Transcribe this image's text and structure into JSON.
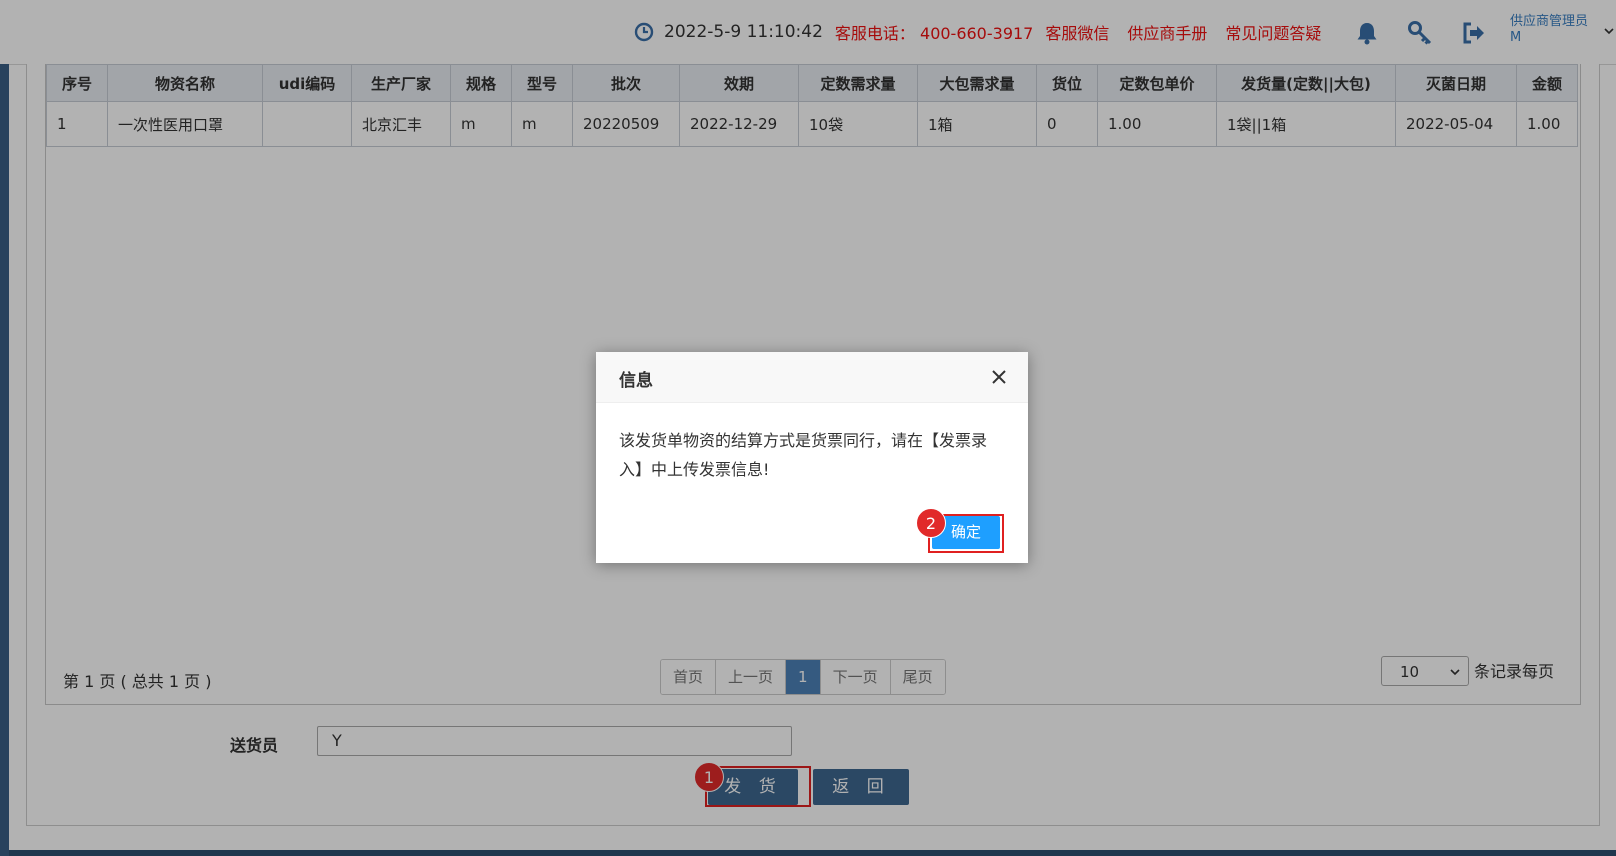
{
  "header": {
    "datetime": "2022-5-9   11:10:42",
    "service_phone": "客服电话：  400-660-3917",
    "service_wechat": "客服微信",
    "supplier_manual": "供应商手册",
    "faq": "常见问题答疑",
    "user_role": "供应商管理员",
    "user_name": "M"
  },
  "table": {
    "columns": [
      "序号",
      "物资名称",
      "udi编码",
      "生产厂家",
      "规格",
      "型号",
      "批次",
      "效期",
      "定数需求量",
      "大包需求量",
      "货位",
      "定数包单价",
      "发货量(定数||大包)",
      "灭菌日期",
      "金额"
    ],
    "rows": [
      [
        "1",
        "一次性医用口罩",
        "",
        "北京汇丰",
        "m",
        "m",
        "20220509",
        "2022-12-29",
        "10袋",
        "1箱",
        "0",
        "1.00",
        "1袋||1箱",
        "2022-05-04",
        "1.00"
      ]
    ]
  },
  "pagination": {
    "info": "第 1 页 ( 总共 1 页 )",
    "first": "首页",
    "prev": "上一页",
    "current": "1",
    "next": "下一页",
    "last": "尾页",
    "per_page": "10",
    "per_page_label": "条记录每页"
  },
  "form": {
    "courier_label": "送货员",
    "courier_value": "Y",
    "ship_label": "发 货",
    "back_label": "返 回"
  },
  "dialog": {
    "title": "信息",
    "message": "该发货单物资的结算方式是货票同行，请在【发票录入】中上传发票信息!",
    "ok_label": "确定"
  },
  "annotations": {
    "badge_1": "1",
    "badge_2": "2",
    "highlight_color": "#e02020"
  },
  "icons": [
    "clock-icon",
    "bell-icon",
    "key-icon",
    "logout-icon",
    "chevron-down-icon",
    "close-icon"
  ]
}
